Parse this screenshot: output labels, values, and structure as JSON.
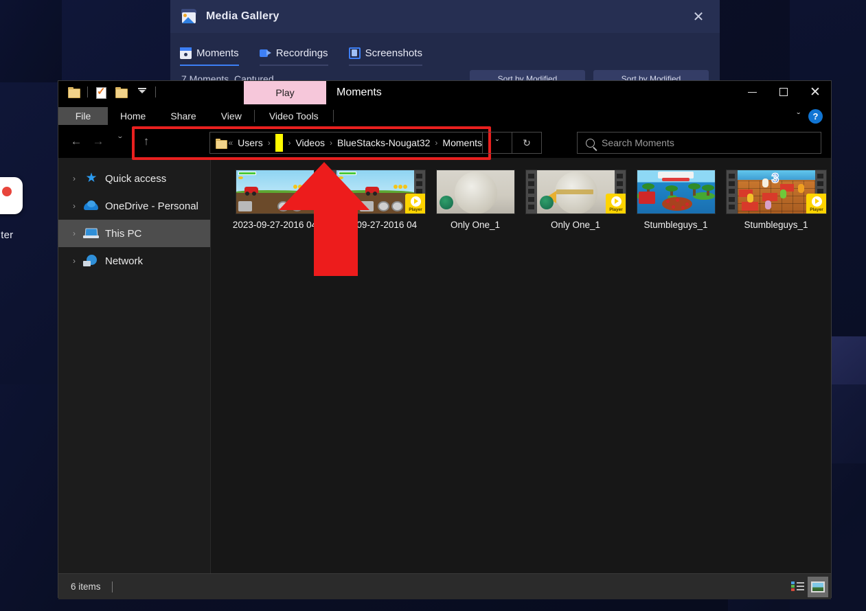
{
  "desktop": {
    "icon_label": "nter",
    "icon_name": "browser-desktop-icon"
  },
  "gallery_window": {
    "title": "Media Gallery",
    "close_label": "✕",
    "tabs": [
      {
        "label": "Moments",
        "icon": "moments-icon",
        "active": true
      },
      {
        "label": "Recordings",
        "icon": "recordings-icon",
        "active": false
      },
      {
        "label": "Screenshots",
        "icon": "screenshots-icon",
        "active": false
      }
    ],
    "subtitle": "7 Moments  Captured",
    "buttons": [
      {
        "label": "Sort by Modified"
      },
      {
        "label": "Sort by Modified"
      }
    ]
  },
  "explorer": {
    "quick_access_toolbar": [
      {
        "name": "folder-icon"
      },
      {
        "name": "properties-icon"
      },
      {
        "name": "new-folder-icon"
      },
      {
        "name": "customize-dropdown-icon"
      }
    ],
    "contextual_tab": "Play",
    "document_title": "Moments",
    "window_controls": {
      "minimize": "–",
      "maximize": "□",
      "close": "✕"
    },
    "ribbon_tabs": [
      {
        "label": "File",
        "active": true
      },
      {
        "label": "Home",
        "active": false
      },
      {
        "label": "Share",
        "active": false
      },
      {
        "label": "View",
        "active": false
      },
      {
        "label": "Video Tools",
        "active": false,
        "contextual": true
      }
    ],
    "ribbon_right": {
      "collapse": "ˇ",
      "help": "?"
    },
    "navigation": {
      "back": "←",
      "forward": "→",
      "recent": "ˇ",
      "up": "↑"
    },
    "address_bar": {
      "overflow": "«",
      "crumbs": [
        {
          "label": "Users",
          "redacted": false
        },
        {
          "label": "",
          "redacted": true
        },
        {
          "label": "Videos",
          "redacted": false
        },
        {
          "label": "BlueStacks-Nougat32",
          "redacted": false
        },
        {
          "label": "Moments",
          "redacted": false
        }
      ],
      "separator": "›",
      "history_dropdown": "ˇ",
      "refresh": "↻",
      "highlight_color": "#e8201f"
    },
    "search": {
      "placeholder": "Search Moments",
      "icon": "search-icon"
    },
    "nav_pane": [
      {
        "label": "Quick access",
        "icon": "star-icon",
        "selected": false
      },
      {
        "label": "OneDrive - Personal",
        "icon": "cloud-icon",
        "selected": false
      },
      {
        "label": "This PC",
        "icon": "pc-icon",
        "selected": true
      },
      {
        "label": "Network",
        "icon": "network-icon",
        "selected": false
      }
    ],
    "files": [
      {
        "name": "2023-09-27-2016 04",
        "art": "hill",
        "filmstrip": false,
        "player_badge": false
      },
      {
        "name": "2023-09-27-2016 04",
        "art": "hill",
        "filmstrip": true,
        "player_badge": true
      },
      {
        "name": "Only One_1",
        "art": "one",
        "filmstrip": false,
        "player_badge": false
      },
      {
        "name": "Only One_1",
        "art": "one",
        "filmstrip": true,
        "player_badge": true
      },
      {
        "name": "Stumbleguys_1",
        "art": "sg1",
        "filmstrip": false,
        "player_badge": false
      },
      {
        "name": "Stumbleguys_1",
        "art": "sg2",
        "filmstrip": true,
        "player_badge": true
      }
    ],
    "player_badge_label": "Player",
    "status_bar": {
      "item_count": "6 items",
      "views": [
        {
          "name": "details-view-button",
          "active": false
        },
        {
          "name": "large-icons-view-button",
          "active": true
        }
      ]
    }
  },
  "annotation": {
    "arrow": "up-arrow-annotation",
    "arrow_color": "#ed1c1c"
  }
}
